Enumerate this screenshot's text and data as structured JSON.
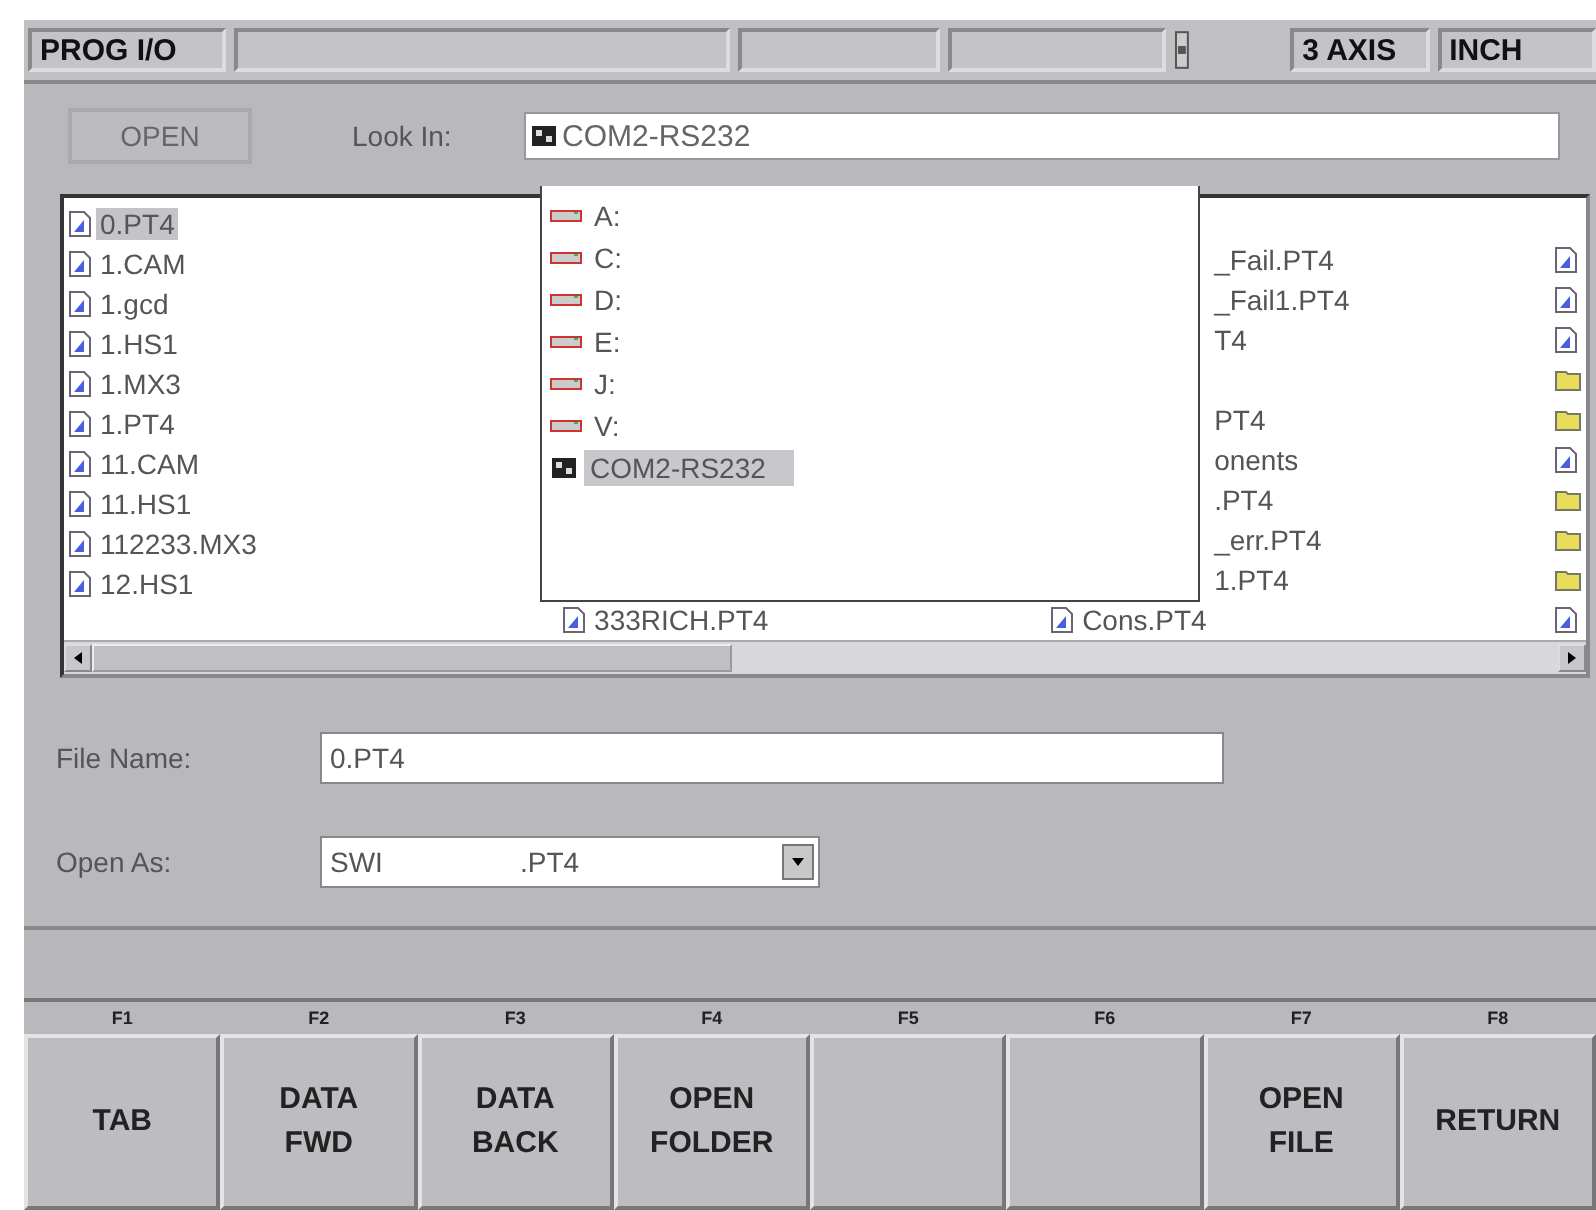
{
  "status_bar": {
    "cells": [
      {
        "kind": "text",
        "text": "PROG I/O"
      },
      {
        "kind": "blank"
      },
      {
        "kind": "blank"
      },
      {
        "kind": "blank"
      },
      {
        "kind": "indicator"
      },
      {
        "kind": "text",
        "text": "3 AXIS"
      },
      {
        "kind": "text",
        "text": "INCH"
      }
    ]
  },
  "dialog": {
    "open_button": "OPEN",
    "look_in_label": "Look In:",
    "look_in_value": "COM2-RS232",
    "dropdown": [
      {
        "kind": "drive",
        "label": "A:",
        "selected": false
      },
      {
        "kind": "drive",
        "label": "C:",
        "selected": false
      },
      {
        "kind": "drive",
        "label": "D:",
        "selected": false
      },
      {
        "kind": "drive",
        "label": "E:",
        "selected": false
      },
      {
        "kind": "drive",
        "label": "J:",
        "selected": false
      },
      {
        "kind": "drive",
        "label": "V:",
        "selected": false
      },
      {
        "kind": "port",
        "label": "COM2-RS232",
        "selected": true
      }
    ],
    "file_list": {
      "column_1": [
        {
          "kind": "file",
          "name": "0.PT4",
          "selected": true
        },
        {
          "kind": "file",
          "name": "1.CAM",
          "selected": false
        },
        {
          "kind": "file",
          "name": "1.gcd",
          "selected": false
        },
        {
          "kind": "file",
          "name": "1.HS1",
          "selected": false
        },
        {
          "kind": "file",
          "name": "1.MX3",
          "selected": false
        },
        {
          "kind": "file",
          "name": "1.PT4",
          "selected": false
        },
        {
          "kind": "file",
          "name": "11.CAM",
          "selected": false
        },
        {
          "kind": "file",
          "name": "11.HS1",
          "selected": false
        },
        {
          "kind": "file",
          "name": "112233.MX3",
          "selected": false
        },
        {
          "kind": "file",
          "name": "12.HS1",
          "selected": false
        }
      ],
      "column_2": [
        {
          "kind": "file",
          "name": "333RICH.PT4"
        }
      ],
      "column_3": [
        {
          "kind": "covered",
          "name": "_Fail.PT4"
        },
        {
          "kind": "covered",
          "name": "_Fail1.PT4"
        },
        {
          "kind": "covered",
          "name": "T4"
        },
        {
          "kind": "covered"
        },
        {
          "kind": "covered",
          "name": "PT4"
        },
        {
          "kind": "covered",
          "name": "onents"
        },
        {
          "kind": "covered",
          "name": ".PT4"
        },
        {
          "kind": "covered",
          "name": "_err.PT4"
        },
        {
          "kind": "covered",
          "name": "1.PT4"
        },
        {
          "kind": "file",
          "name": "Cons.PT4"
        }
      ],
      "column_4": [
        {
          "kind": "file"
        },
        {
          "kind": "file"
        },
        {
          "kind": "file"
        },
        {
          "kind": "folder"
        },
        {
          "kind": "folder"
        },
        {
          "kind": "file"
        },
        {
          "kind": "folder"
        },
        {
          "kind": "folder"
        },
        {
          "kind": "folder"
        },
        {
          "kind": "file"
        }
      ]
    },
    "file_name_label": "File Name:",
    "file_name_value": "0.PT4",
    "open_as_label": "Open As:",
    "open_as_value": "SWI",
    "open_as_ext": ".PT4"
  },
  "softkeys": [
    {
      "key": "F1",
      "label": [
        "TAB"
      ]
    },
    {
      "key": "F2",
      "label": [
        "DATA",
        "FWD"
      ]
    },
    {
      "key": "F3",
      "label": [
        "DATA",
        "BACK"
      ]
    },
    {
      "key": "F4",
      "label": [
        "OPEN",
        "FOLDER"
      ]
    },
    {
      "key": "F5"
    },
    {
      "key": "F6"
    },
    {
      "key": "F7",
      "label": [
        "OPEN",
        "FILE"
      ]
    },
    {
      "key": "F8",
      "label": [
        "RETURN"
      ]
    }
  ]
}
